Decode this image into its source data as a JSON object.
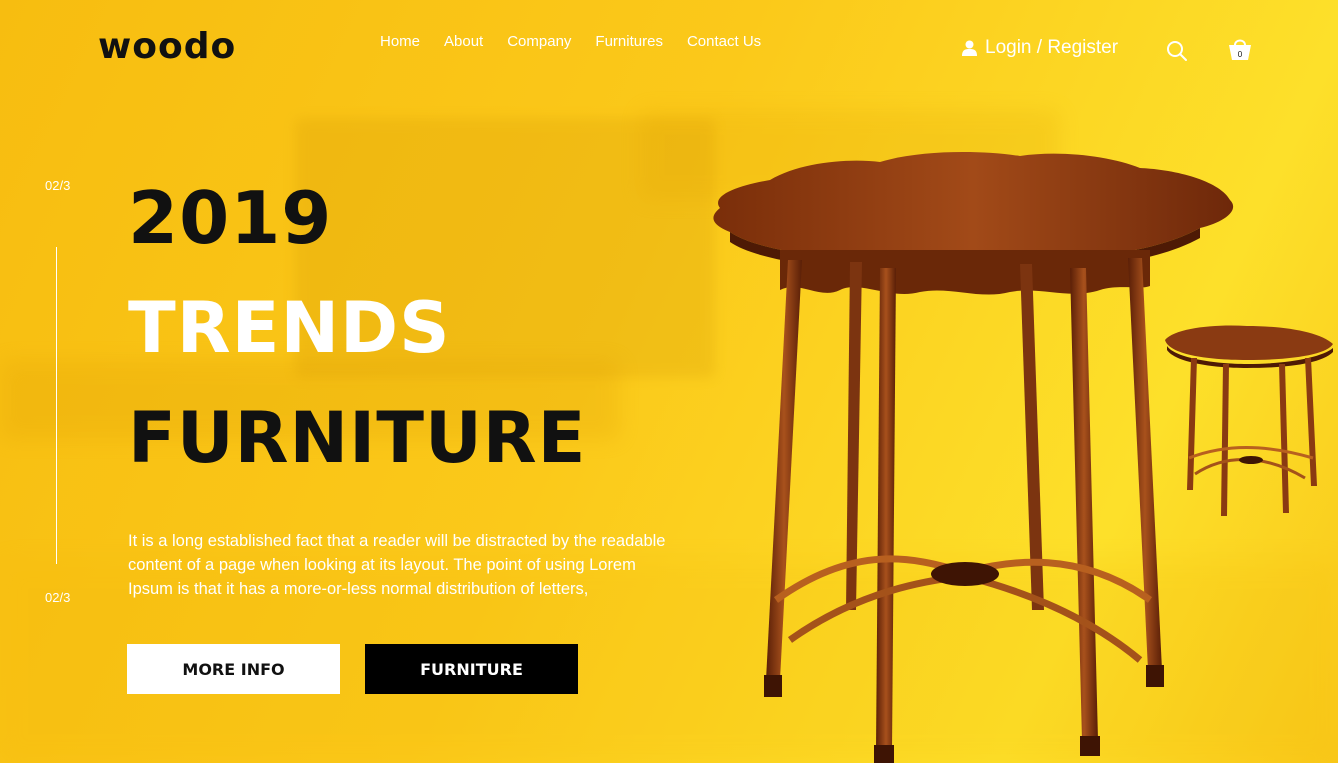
{
  "brand": {
    "logo": "woodo"
  },
  "nav": {
    "items": [
      {
        "label": "Home"
      },
      {
        "label": "About"
      },
      {
        "label": "Company"
      },
      {
        "label": "Furnitures"
      },
      {
        "label": "Contact Us"
      }
    ]
  },
  "header": {
    "login_label": "Login / Register",
    "cart_count": "0",
    "icons": [
      "user-icon",
      "search-icon",
      "cart-icon"
    ]
  },
  "slider": {
    "current_top": "02/3",
    "current_bottom": "02/3"
  },
  "hero": {
    "line1": "2019",
    "line2": "TRENDS",
    "line3": "FURNITURE",
    "description": "It is a long established fact that a reader will be distracted by the readable content of a page when looking at its layout. The point of using Lorem Ipsum is that it has a more-or-less normal distribution of letters,",
    "more_info_label": "MORE INFO",
    "furniture_label": "FURNITURE"
  },
  "colors": {
    "background": "#fbc91a",
    "text_dark": "#111111",
    "text_light": "#ffffff",
    "wood": "#8a3a12"
  }
}
